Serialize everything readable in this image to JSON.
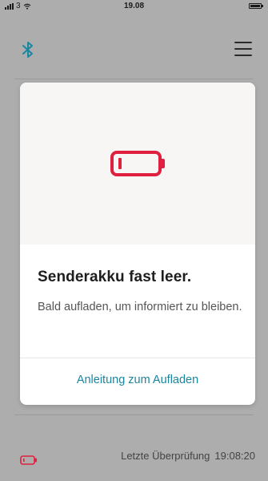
{
  "status_bar": {
    "carrier": "3",
    "time": "19.08"
  },
  "header": {
    "bluetooth_icon": "bluetooth-icon",
    "menu_icon": "hamburger-menu-icon"
  },
  "card": {
    "icon": "battery-low-icon",
    "title": "Senderakku fast leer.",
    "message": "Bald aufladen, um informiert zu bleiben.",
    "action_label": "Anleitung zum Aufladen"
  },
  "footer": {
    "battery_icon": "battery-low-icon",
    "last_check_label": "Letzte Überprüfung",
    "last_check_time": "19:08:20"
  },
  "colors": {
    "accent": "#1a86a0",
    "alert": "#e0203f",
    "bluetooth": "#1a86a0"
  }
}
